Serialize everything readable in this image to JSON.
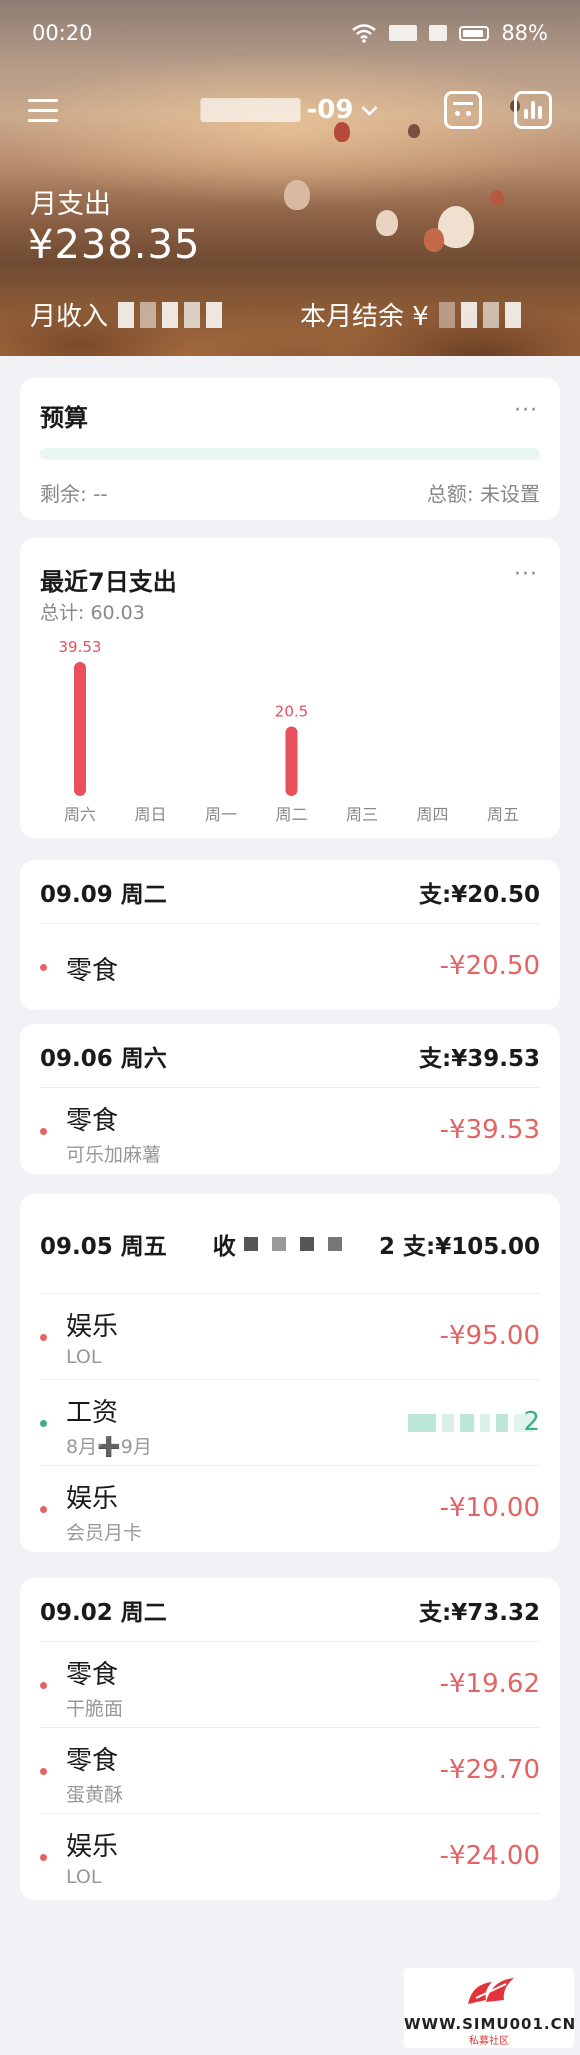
{
  "status_bar": {
    "time": "00:20",
    "battery": "88%"
  },
  "header": {
    "month_title_suffix": "-09",
    "month_expense_label": "月支出",
    "month_expense_amount": "¥238.35",
    "income_label": "月收入",
    "balance_label": "本月结余 ¥",
    "icons": [
      "menu-icon",
      "calendar-icon",
      "stats-icon",
      "chevron-down-icon"
    ]
  },
  "budget": {
    "title": "预算",
    "more": "···",
    "remain": "剩余: --",
    "total": "总额: 未设置"
  },
  "week": {
    "title": "最近7日支出",
    "more": "···",
    "total": "总计: 60.03"
  },
  "chart_data": {
    "type": "bar",
    "title": "最近7日支出",
    "categories": [
      "周六",
      "周日",
      "周一",
      "周二",
      "周三",
      "周四",
      "周五"
    ],
    "values": [
      39.53,
      0,
      0,
      20.5,
      0,
      0,
      0
    ],
    "labels": [
      "39.53",
      "",
      "",
      "20.5",
      "",
      "",
      ""
    ],
    "bar_color": "#e8505b",
    "grid": false
  },
  "days": [
    {
      "date": "09.09 周二",
      "total": "支:¥20.50",
      "items": [
        {
          "cat": "零食",
          "note": "",
          "amount": "-¥20.50",
          "type": "expense"
        }
      ]
    },
    {
      "date": "09.06 周六",
      "total": "支:¥39.53",
      "items": [
        {
          "cat": "零食",
          "note": "可乐加麻薯",
          "amount": "-¥39.53",
          "type": "expense"
        }
      ]
    },
    {
      "date": "09.05 周五",
      "income_label": "收",
      "total": "2 支:¥105.00",
      "items": [
        {
          "cat": "娱乐",
          "note": "LOL",
          "amount": "-¥95.00",
          "type": "expense"
        },
        {
          "cat": "工资",
          "note": "8月➕9月",
          "amount": "2",
          "type": "income"
        },
        {
          "cat": "娱乐",
          "note": "会员月卡",
          "amount": "-¥10.00",
          "type": "expense"
        }
      ]
    },
    {
      "date": "09.02 周二",
      "total": "支:¥73.32",
      "items": [
        {
          "cat": "零食",
          "note": "干脆面",
          "amount": "-¥19.62",
          "type": "expense"
        },
        {
          "cat": "零食",
          "note": "蛋黄酥",
          "amount": "-¥29.70",
          "type": "expense"
        },
        {
          "cat": "娱乐",
          "note": "LOL",
          "amount": "-¥24.00",
          "type": "expense"
        }
      ]
    }
  ],
  "watermark": {
    "text": "WWW.SIMU001.CN",
    "sub": "私募社区"
  },
  "colors": {
    "expense": "#e26464",
    "income": "#3eae8a",
    "bar": "#e8505b"
  }
}
